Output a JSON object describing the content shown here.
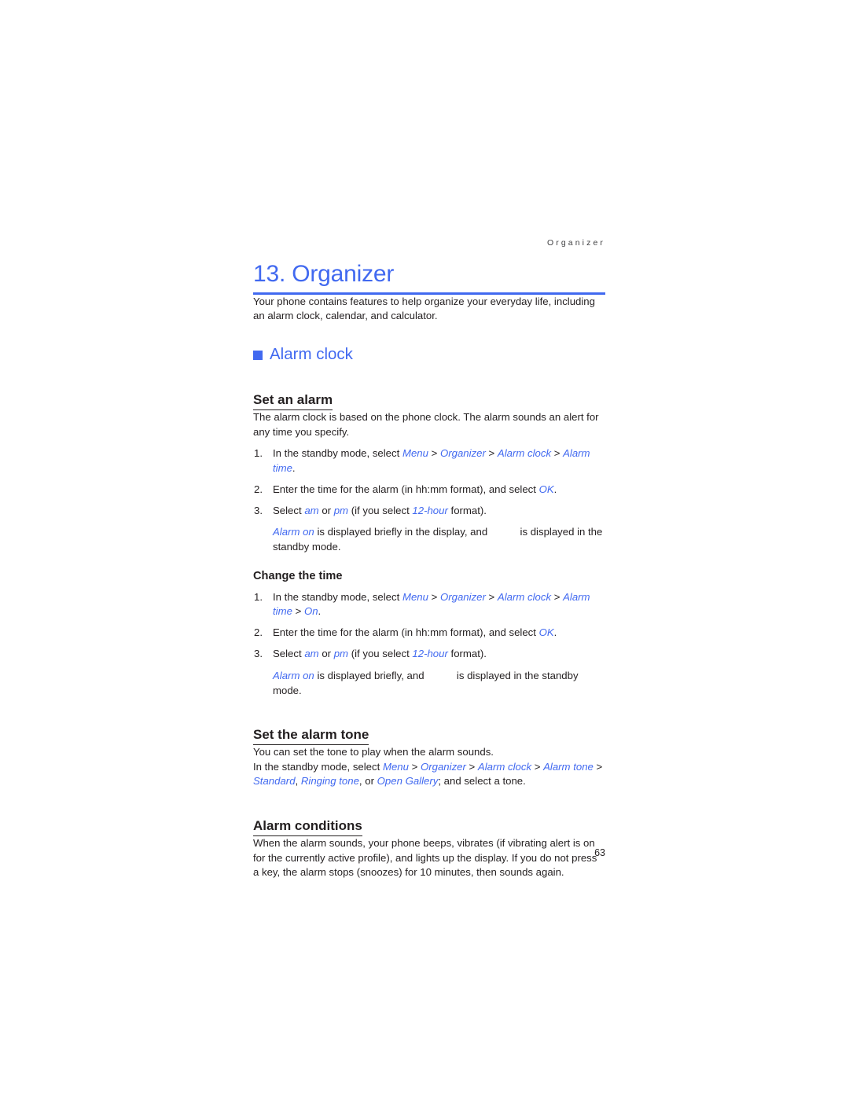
{
  "colors": {
    "accent_blue": "#4169f0",
    "body_text": "#231f20"
  },
  "running_header": "Organizer",
  "chapter": {
    "title": "13. Organizer",
    "intro": "Your phone contains features to help organize your everyday life, including an alarm clock, calendar, and calculator."
  },
  "section": {
    "bullet_icon": "square-bullet-icon",
    "heading": "Alarm clock"
  },
  "set_an_alarm": {
    "heading": "Set an alarm",
    "intro": "The alarm clock is based on the phone clock. The alarm sounds an alert for any time you specify.",
    "steps": [
      {
        "number": "1.",
        "lead": "In the standby mode, select ",
        "refs": [
          "Menu",
          "Organizer",
          "Alarm clock",
          "Alarm time"
        ],
        "separator": " > ",
        "trail": "."
      },
      {
        "number": "2.",
        "lead": "Enter the time for the alarm (in hh:mm format), and select ",
        "refs": [
          "OK"
        ],
        "trail": "."
      },
      {
        "number": "3.",
        "lead": "Select ",
        "ref_am": "am",
        "mid": " or ",
        "ref_pm": "pm",
        "mid2": " (if you select ",
        "ref_format": "12-hour",
        "trail": " format)."
      }
    ],
    "note": {
      "ref": "Alarm on",
      "text_before": " is displayed briefly in the display, and ",
      "text_after": " is displayed in the standby mode."
    }
  },
  "change_the_time": {
    "heading": "Change the time",
    "steps": [
      {
        "number": "1.",
        "lead": "In the standby mode, select ",
        "refs": [
          "Menu",
          "Organizer",
          "Alarm clock",
          "Alarm time",
          "On"
        ],
        "separator": " > ",
        "trail": "."
      },
      {
        "number": "2.",
        "lead": "Enter the time for the alarm (in hh:mm format), and select ",
        "refs": [
          "OK"
        ],
        "trail": "."
      },
      {
        "number": "3.",
        "lead": "Select ",
        "ref_am": "am",
        "mid": " or ",
        "ref_pm": "pm",
        "mid2": " (if you select ",
        "ref_format": "12-hour",
        "trail": " format)."
      }
    ],
    "note": {
      "ref": "Alarm on",
      "text_before": " is displayed briefly, and ",
      "text_after": " is displayed in the standby mode."
    }
  },
  "set_the_alarm_tone": {
    "heading": "Set the alarm tone",
    "intro": "You can set the tone to play when the alarm sounds.",
    "path": {
      "lead": "In the standby mode, select ",
      "refs": [
        "Menu",
        "Organizer",
        "Alarm clock",
        "Alarm tone"
      ],
      "separator": " > ",
      "options": [
        "Standard",
        "Ringing tone",
        "Open Gallery"
      ],
      "option_join_1": ", ",
      "option_join_2": ", or ",
      "trail": "; and select a tone."
    }
  },
  "alarm_conditions": {
    "heading": "Alarm conditions",
    "body": "When the alarm sounds, your phone beeps, vibrates (if vibrating alert is on for the currently active profile), and lights up the display. If you do not press a key, the alarm stops (snoozes) for 10 minutes, then sounds again."
  },
  "page_number": "63"
}
